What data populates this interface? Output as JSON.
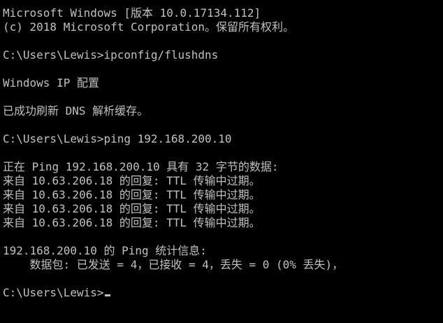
{
  "terminal": {
    "colors": {
      "background": "#000000",
      "foreground": "#c0c0c0"
    },
    "lines": [
      "Microsoft Windows [版本 10.0.17134.112]",
      "(c) 2018 Microsoft Corporation。保留所有权利。",
      "",
      "C:\\Users\\Lewis>ipconfig/flushdns",
      "",
      "Windows IP 配置",
      "",
      "已成功刷新 DNS 解析缓存。",
      "",
      "C:\\Users\\Lewis>ping 192.168.200.10",
      "",
      "正在 Ping 192.168.200.10 具有 32 字节的数据:",
      "来自 10.63.206.18 的回复: TTL 传输中过期。",
      "来自 10.63.206.18 的回复: TTL 传输中过期。",
      "来自 10.63.206.18 的回复: TTL 传输中过期。",
      "来自 10.63.206.18 的回复: TTL 传输中过期。",
      "",
      "192.168.200.10 的 Ping 统计信息:",
      "    数据包: 已发送 = 4，已接收 = 4，丢失 = 0 (0% 丢失)，",
      ""
    ],
    "prompt": "C:\\Users\\Lewis>"
  }
}
